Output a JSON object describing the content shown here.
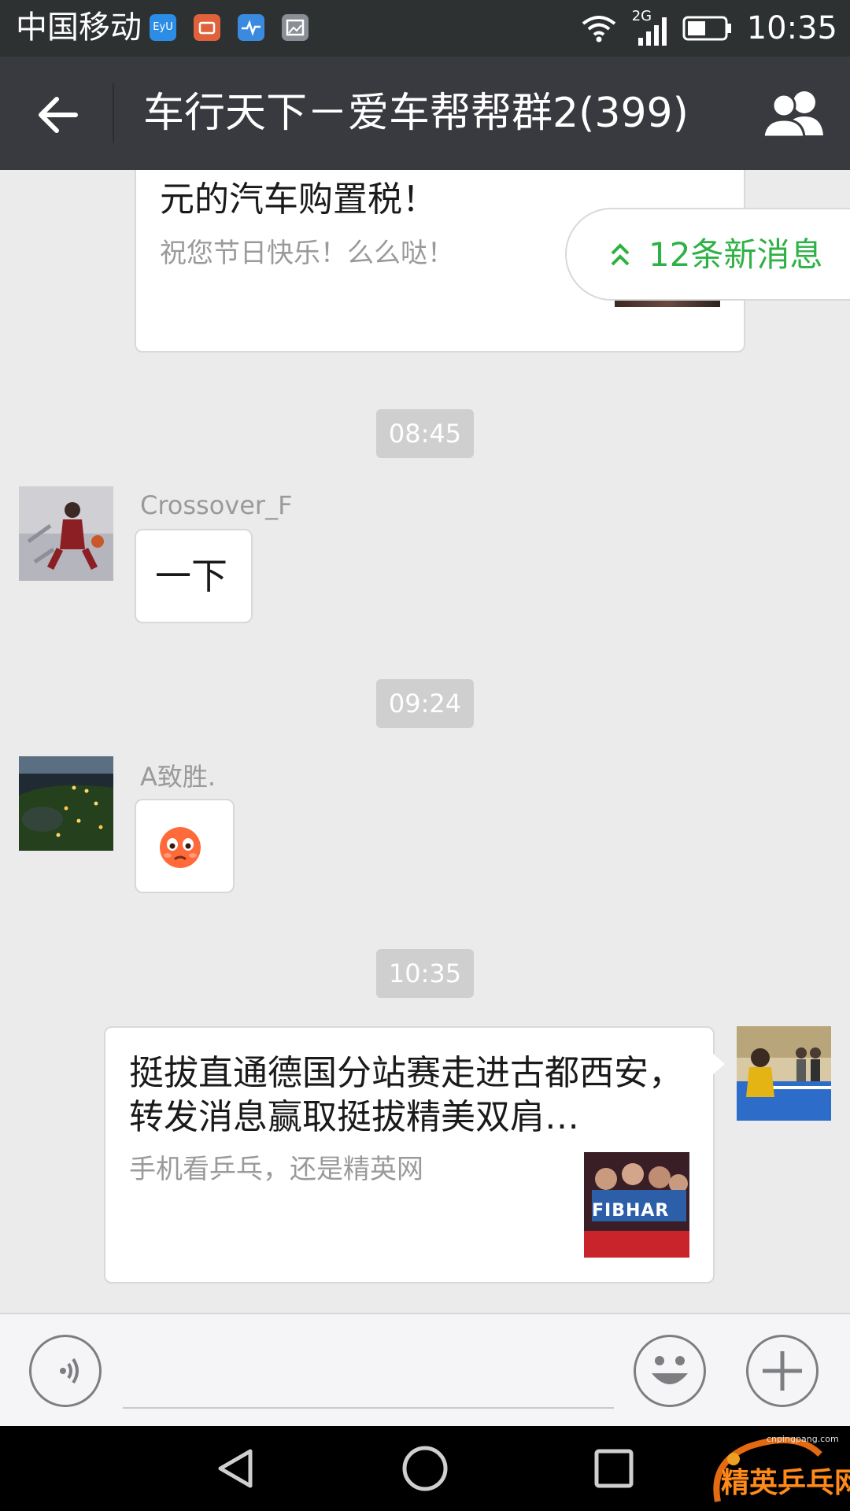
{
  "status_bar": {
    "carrier": "中国移动",
    "apps": [
      {
        "name": "app-eyu-icon",
        "label": "EyU",
        "color": "#2c8de6"
      },
      {
        "name": "app-mail-icon",
        "label": "",
        "color": "#e0623c"
      },
      {
        "name": "app-health-icon",
        "label": "",
        "color": "#3a8ae0"
      },
      {
        "name": "app-gallery-icon",
        "label": "",
        "color": "#8a8f96"
      }
    ],
    "network": "2G",
    "time": "10:35"
  },
  "header": {
    "title": "车行天下－爱车帮帮群2(399)",
    "back_icon": "back-arrow-icon",
    "members_icon": "group-members-icon"
  },
  "new_messages": {
    "label": "12条新消息",
    "color": "#2fb245"
  },
  "messages": [
    {
      "type": "link-card",
      "title": "元的汽车购置税！",
      "description": "祝您节日快乐！么么哒！"
    },
    {
      "type": "timestamp",
      "text": "08:45"
    },
    {
      "type": "text",
      "sender": "Crossover_F",
      "text": "一下"
    },
    {
      "type": "timestamp",
      "text": "09:24"
    },
    {
      "type": "emoji",
      "sender": "A致胜.",
      "emoji": "flushed-face-icon"
    },
    {
      "type": "timestamp",
      "text": "10:35"
    },
    {
      "type": "link-card",
      "outgoing": true,
      "title": "挺拔直通德国分站赛走进古都西安，转发消息赢取挺拔精美双肩…",
      "description": "手机看乒乓，还是精英网",
      "thumbnail_text": "FIBHAR"
    }
  ],
  "input_bar": {
    "voice_icon": "voice-input-icon",
    "emoji_icon": "emoji-smile-icon",
    "plus_icon": "more-plus-icon"
  },
  "nav_bar": {
    "watermark_domain": "cnpingpang.com",
    "watermark_text": "精英乒乓网"
  }
}
